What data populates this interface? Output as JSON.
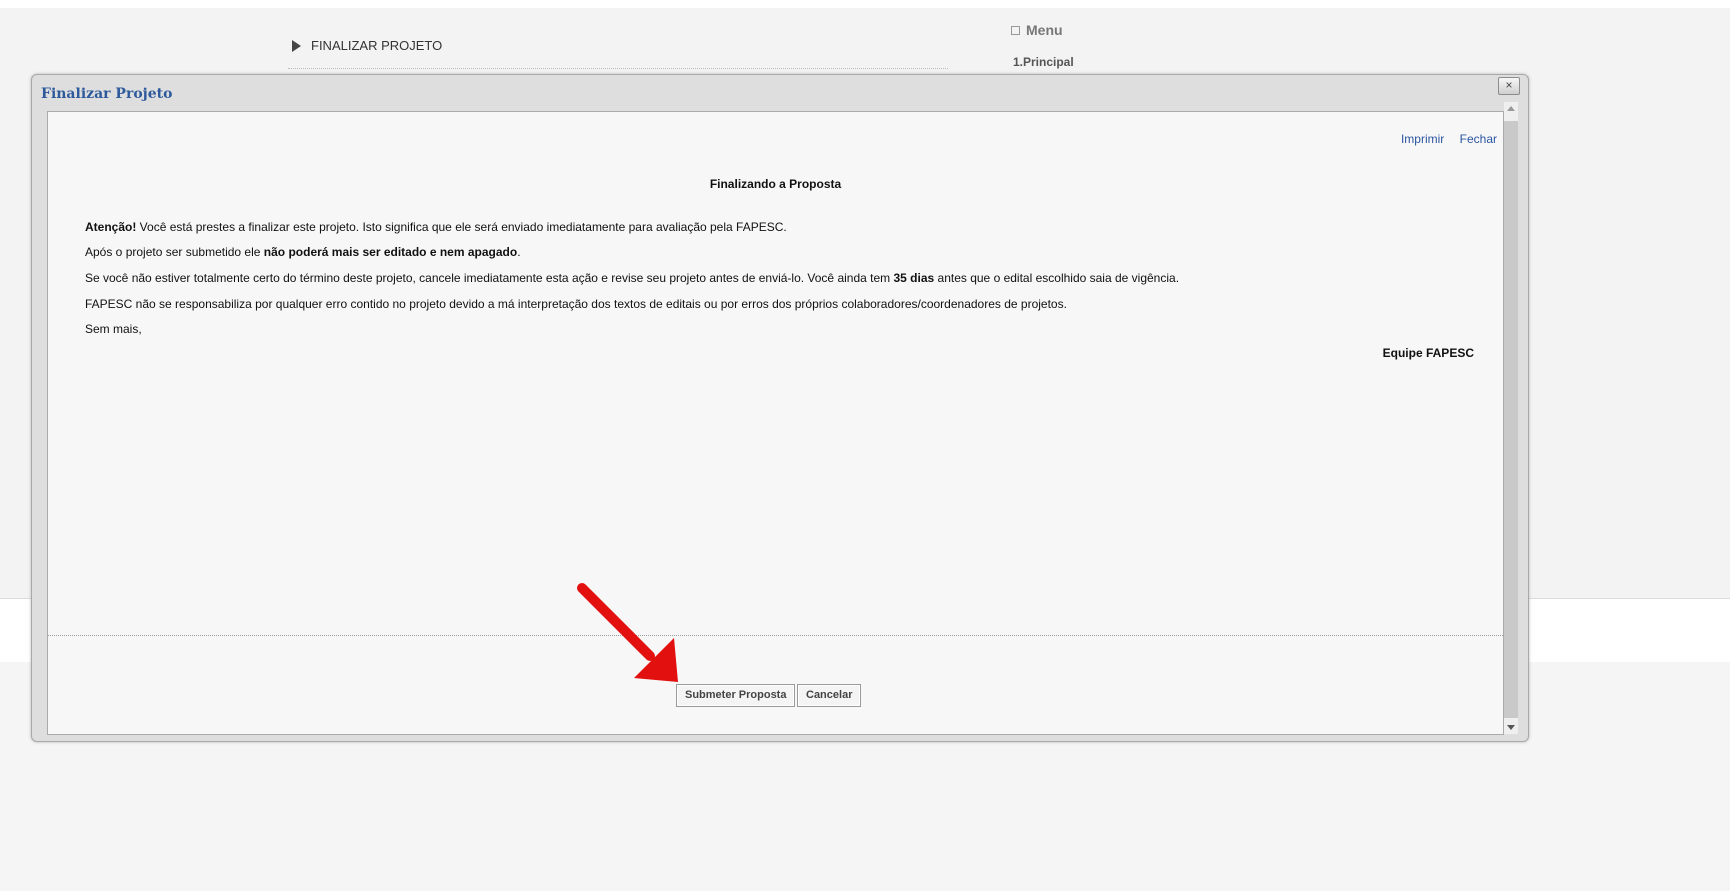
{
  "background": {
    "page_heading": "FINALIZAR PROJETO",
    "menu_title": "Menu",
    "menu_items": [
      "1.Principal"
    ]
  },
  "dialog": {
    "title": "Finalizar Projeto",
    "close_label": "×",
    "links": {
      "print": "Imprimir",
      "close": "Fechar"
    },
    "doc_title": "Finalizando a Proposta",
    "paragraphs": {
      "p1_bold": "Atenção!",
      "p1_text": " Você está prestes a finalizar este projeto. Isto significa que ele será enviado imediatamente para avaliação pela FAPESC.",
      "p2_text": "Após o projeto ser submetido ele ",
      "p2_bold": "não poderá mais ser editado e nem apagado",
      "p2_end": ".",
      "p3_text": "Se você não estiver totalmente certo do término deste projeto, cancele imediatamente esta ação e revise seu projeto antes de enviá-lo. Você ainda tem ",
      "p3_bold": "35 dias",
      "p3_end": " antes que o edital escolhido saia de vigência.",
      "p4_text": "FAPESC não se responsabiliza por qualquer erro contido no projeto devido a má interpretação dos textos de editais ou por erros dos próprios colaboradores/coordenadores de projetos.",
      "p5_text": "Sem mais,"
    },
    "signature": "Equipe FAPESC",
    "buttons": {
      "submit": "Submeter Proposta",
      "cancel": "Cancelar"
    }
  },
  "colors": {
    "title_blue": "#2e5a9c",
    "link_blue": "#2b55a0",
    "arrow_red": "#e31010"
  },
  "icons": [
    "chevron-right-icon",
    "menu-square-icon",
    "close-icon",
    "scroll-up-icon",
    "scroll-down-icon",
    "red-arrow-icon"
  ]
}
